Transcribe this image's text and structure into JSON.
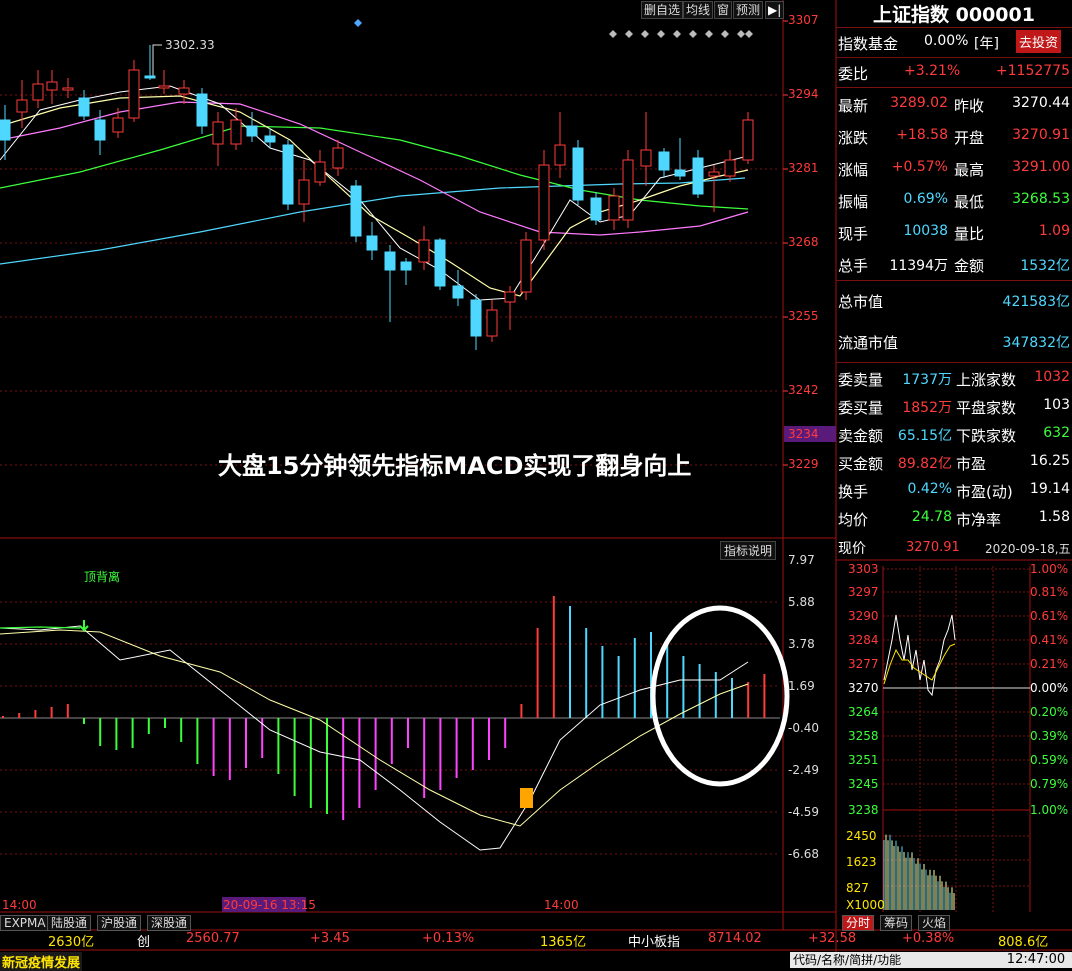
{
  "toolbar": {
    "items": [
      "删自选",
      "均线",
      "窗",
      "预测"
    ],
    "arrow": "▶|"
  },
  "title": "上证指数 000001",
  "fund": {
    "label": "指数基金",
    "value": "0.00%",
    "suffix": "[年]",
    "button": "去投资"
  },
  "weibi": {
    "label": "委比",
    "pct": "+3.21%",
    "val": "+1152775"
  },
  "quote_rows": [
    {
      "l1": "最新",
      "v1": "3289.02",
      "c1": "red",
      "l2": "昨收",
      "v2": "3270.44",
      "c2": "white"
    },
    {
      "l1": "涨跌",
      "v1": "+18.58",
      "c1": "red",
      "l2": "开盘",
      "v2": "3270.91",
      "c2": "red"
    },
    {
      "l1": "涨幅",
      "v1": "+0.57%",
      "c1": "red",
      "l2": "最高",
      "v2": "3291.00",
      "c2": "red"
    },
    {
      "l1": "振幅",
      "v1": "0.69%",
      "c1": "cyan",
      "l2": "最低",
      "v2": "3268.53",
      "c2": "green"
    },
    {
      "l1": "现手",
      "v1": "10038",
      "c1": "cyan",
      "l2": "量比",
      "v2": "1.09",
      "c2": "red"
    },
    {
      "l1": "总手",
      "v1": "11394万",
      "c1": "white",
      "l2": "金额",
      "v2": "1532亿",
      "c2": "cyan"
    }
  ],
  "mcap": {
    "label": "总市值",
    "value": "421583亿"
  },
  "fcap": {
    "label": "流通市值",
    "value": "347832亿"
  },
  "stats_rows": [
    {
      "l1": "委卖量",
      "v1": "1737万",
      "c1": "cyan",
      "l2": "上涨家数",
      "v2": "1032",
      "c2": "red"
    },
    {
      "l1": "委买量",
      "v1": "1852万",
      "c1": "red",
      "l2": "平盘家数",
      "v2": "103",
      "c2": "white"
    },
    {
      "l1": "卖金额",
      "v1": "65.15亿",
      "c1": "cyan",
      "l2": "下跌家数",
      "v2": "632",
      "c2": "green"
    },
    {
      "l1": "买金额",
      "v1": "89.82亿",
      "c1": "red",
      "l2": "市盈",
      "v2": "16.25",
      "c2": "white"
    },
    {
      "l1": "换手",
      "v1": "0.42%",
      "c1": "cyan",
      "l2": "市盈(动)",
      "v2": "19.14",
      "c2": "white"
    },
    {
      "l1": "均价",
      "v1": "24.78",
      "c1": "green",
      "l2": "市净率",
      "v2": "1.58",
      "c2": "white"
    }
  ],
  "mini": {
    "label": "现价",
    "price": "3270.91",
    "date": "2020-09-18,五",
    "left_ticks": [
      "3303",
      "3297",
      "3290",
      "3284",
      "3277",
      "3270",
      "3264",
      "3258",
      "3251",
      "3245",
      "3238"
    ],
    "right_ticks": [
      "1.00%",
      "0.81%",
      "0.61%",
      "0.41%",
      "0.21%",
      "0.00%",
      "0.20%",
      "0.39%",
      "0.59%",
      "0.79%",
      "1.00%"
    ],
    "vol_ticks": [
      "2450",
      "1623",
      "827",
      "X1000"
    ],
    "tabs": [
      "分时",
      "筹码",
      "火焰"
    ]
  },
  "main_price_axis": [
    "3307",
    "3294",
    "3281",
    "3268",
    "3255",
    "3242",
    "3229"
  ],
  "current_price_tag": "3234",
  "high_label": "3302.33",
  "annotation": "大盘15分钟领先指标MACD实现了翻身向上",
  "macd_axis": [
    "7.97",
    "5.88",
    "3.78",
    "1.69",
    "-0.40",
    "-2.49",
    "-4.59",
    "-6.68"
  ],
  "macd_label": "顶背离",
  "indicator_btn": "指标说明",
  "time_labels": [
    "14:00",
    "20-09-16 13:15",
    "14:00"
  ],
  "indicator_tabs": [
    "EXPMA",
    "陆股通",
    "沪股通",
    "深股通"
  ],
  "bottom_bar": {
    "a1": "2630亿",
    "a2": "创",
    "a3": "2560.77",
    "a4": "+3.45",
    "a5": "+0.13%",
    "a6": "1365亿",
    "a7": "中小板指",
    "a8": "8714.02",
    "a9": "+32.58",
    "a10": "+0.38%",
    "a11": "808.6亿"
  },
  "status": {
    "news": "新冠疫情发展",
    "search": "代码/名称/简拼/功能",
    "time": "12:47:00"
  },
  "colors": {
    "up": "#ff3b3b",
    "down": "#4fd8ff",
    "grid": "#7a1010",
    "panel_bg": "#000000"
  }
}
